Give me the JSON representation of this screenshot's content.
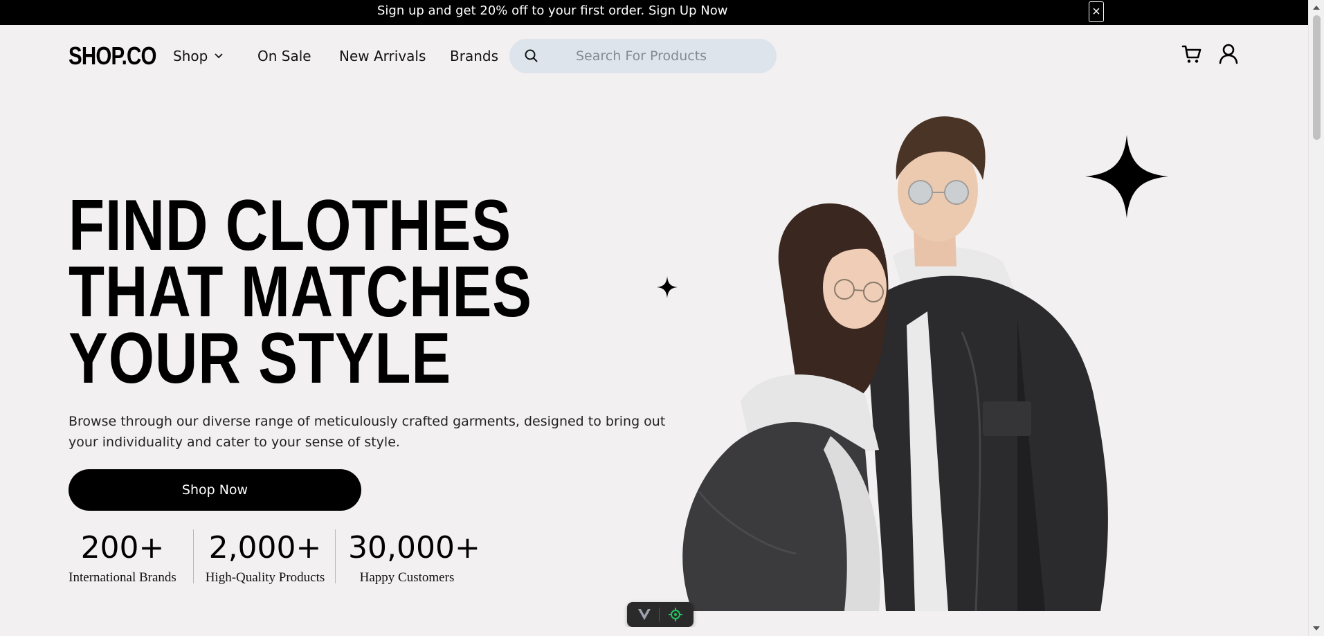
{
  "announcement": {
    "text": "Sign up and get 20% off to your first order. Sign Up Now",
    "close_label": "×"
  },
  "header": {
    "logo": "SHOP.CO",
    "nav": {
      "shop": "Shop",
      "on_sale": "On Sale",
      "new_arrivals": "New Arrivals",
      "brands": "Brands"
    },
    "search": {
      "placeholder": "Search For Products",
      "value": ""
    },
    "icons": [
      "cart-icon",
      "user-icon",
      "search-icon",
      "chevron-down-icon"
    ]
  },
  "hero": {
    "title_lines": [
      "FIND CLOTHES",
      "THAT MATCHES",
      "YOUR STYLE"
    ],
    "description": "Browse through our diverse range of meticulously crafted garments, designed to bring out your individuality and cater to your sense of style.",
    "cta": "Shop Now",
    "stats": [
      {
        "value": "200+",
        "label": "International Brands"
      },
      {
        "value": "2,000+",
        "label": "High-Quality Products"
      },
      {
        "value": "30,000+",
        "label": "Happy Customers"
      }
    ]
  },
  "colors": {
    "background": "#f2f0f1",
    "primary": "#000000",
    "search_bg": "#dee4ec",
    "toolbar_accent": "#22c55e"
  }
}
